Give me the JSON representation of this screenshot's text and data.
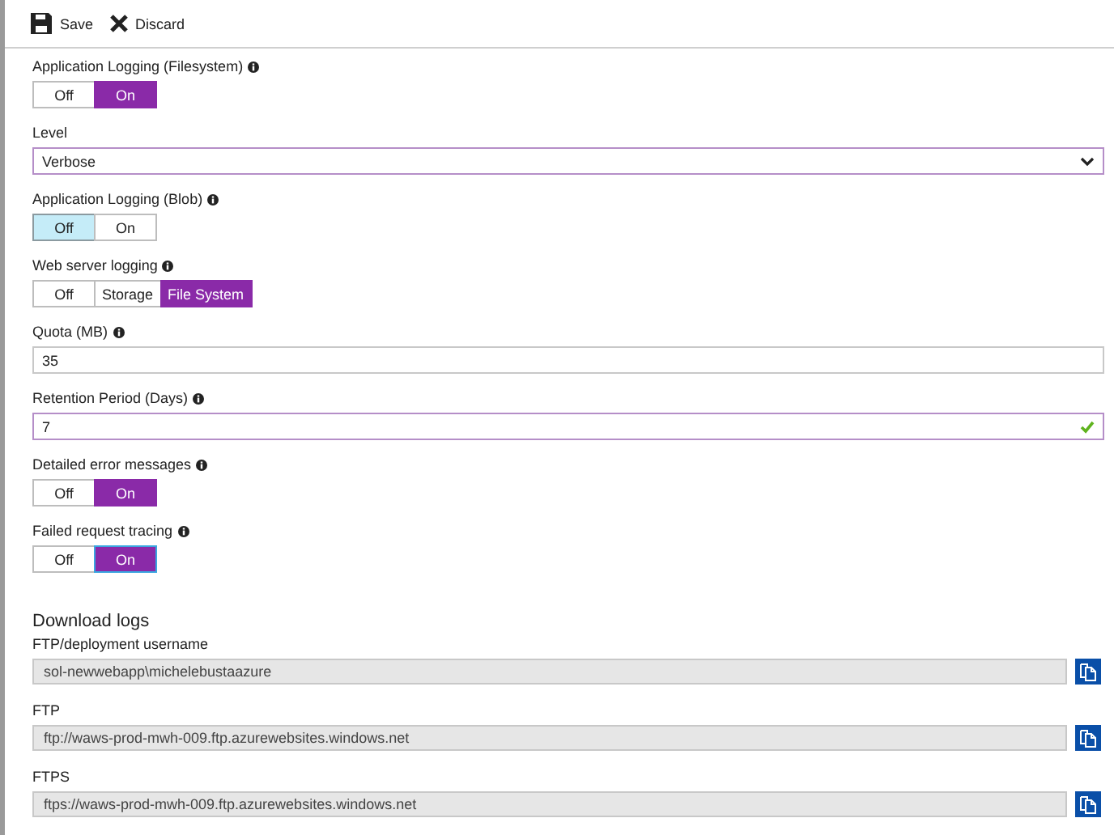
{
  "toolbar": [
    {
      "kind": "save",
      "label": "Save"
    },
    {
      "kind": "discard",
      "label": "Discard"
    }
  ],
  "settings": [
    {
      "kind": "toggle",
      "label": "Application Logging (Filesystem)",
      "info": true,
      "focused": false,
      "options": [
        {
          "label": "Off",
          "selected": false,
          "hovered": false
        },
        {
          "label": "On",
          "selected": true,
          "hovered": false
        }
      ]
    },
    {
      "kind": "select",
      "label": "Level",
      "info": false,
      "focused": true,
      "value": "Verbose"
    },
    {
      "kind": "toggle",
      "label": "Application Logging (Blob)",
      "info": true,
      "focused": false,
      "options": [
        {
          "label": "Off",
          "selected": true,
          "hovered": true
        },
        {
          "label": "On",
          "selected": false,
          "hovered": false
        }
      ]
    },
    {
      "kind": "toggle",
      "label": "Web server logging",
      "info": true,
      "focused": false,
      "options": [
        {
          "label": "Off",
          "selected": false,
          "hovered": false
        },
        {
          "label": "Storage",
          "selected": false,
          "hovered": false
        },
        {
          "label": "File System",
          "selected": true,
          "hovered": false
        }
      ]
    },
    {
      "kind": "text",
      "label": "Quota (MB)",
      "info": true,
      "focused": false,
      "valid": false,
      "value": "35"
    },
    {
      "kind": "text",
      "label": "Retention Period (Days)",
      "info": true,
      "focused": true,
      "valid": true,
      "value": "7"
    },
    {
      "kind": "toggle",
      "label": "Detailed error messages",
      "info": true,
      "focused": false,
      "options": [
        {
          "label": "Off",
          "selected": false,
          "hovered": false
        },
        {
          "label": "On",
          "selected": true,
          "hovered": false
        }
      ]
    },
    {
      "kind": "toggle",
      "label": "Failed request tracing",
      "info": true,
      "focused": true,
      "options": [
        {
          "label": "Off",
          "selected": false,
          "hovered": false
        },
        {
          "label": "On",
          "selected": true,
          "hovered": false
        }
      ]
    }
  ],
  "download_logs": {
    "title": "Download logs",
    "fields": [
      {
        "label": "FTP/deployment username",
        "value": "sol-newwebapp\\michelebustaazure"
      },
      {
        "label": "FTP",
        "value": "ftp://waws-prod-mwh-009.ftp.azurewebsites.windows.net"
      },
      {
        "label": "FTPS",
        "value": "ftps://waws-prod-mwh-009.ftp.azurewebsites.windows.net"
      }
    ]
  }
}
